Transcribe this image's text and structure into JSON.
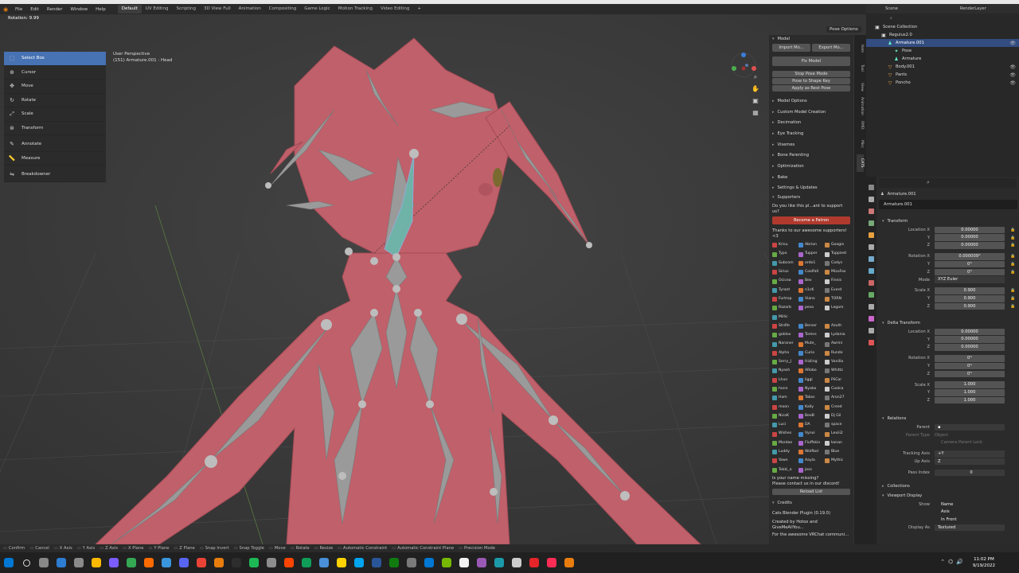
{
  "menubar": {
    "menus": [
      "File",
      "Edit",
      "Render",
      "Window",
      "Help"
    ],
    "workspaces": [
      "Default",
      "UV Editing",
      "Scripting",
      "3D View Full",
      "Animation",
      "Compositing",
      "Game Logic",
      "Motion Tracking",
      "Video Editing",
      "+"
    ],
    "active_workspace": "Default"
  },
  "viewport": {
    "operator_label": "Rotation: 9.99",
    "perspective": "User Perspective",
    "object_info": "(151) Armature.001 : Head",
    "pose_options": "Pose Options"
  },
  "toolbar": {
    "tools": [
      {
        "label": "Select Box",
        "icon": "select-box-icon",
        "glyph": "⬚"
      },
      {
        "label": "Cursor",
        "icon": "cursor-icon",
        "glyph": "⊕"
      },
      {
        "label": "Move",
        "icon": "move-icon",
        "glyph": "✥"
      },
      {
        "label": "Rotate",
        "icon": "rotate-icon",
        "glyph": "↻"
      },
      {
        "label": "Scale",
        "icon": "scale-icon",
        "glyph": "⤢"
      },
      {
        "label": "Transform",
        "icon": "transform-icon",
        "glyph": "⊛"
      },
      {
        "label": "Annotate",
        "icon": "annotate-icon",
        "glyph": "✎"
      },
      {
        "label": "Measure",
        "icon": "measure-icon",
        "glyph": "📏"
      },
      {
        "label": "Breakdowner",
        "icon": "breakdowner-icon",
        "glyph": "⇋"
      }
    ]
  },
  "npanel": {
    "model_header": "Model",
    "import_label": "Import Mo...",
    "export_label": "Export Mo...",
    "fix_model": "Fix Model",
    "stop_pose_mode": "Stop Pose Mode",
    "pose_to_shape_key": "Pose to Shape Key",
    "apply_as_rest_pose": "Apply as Rest Pose",
    "sections": [
      "Model Options",
      "Custom Model Creation",
      "Decimation",
      "Eye Tracking",
      "Visemes",
      "Bone Parenting",
      "Optimization",
      "Bake",
      "Settings & Updates"
    ],
    "supporters_header": "Supporters",
    "support_question": "Do you like this pl...ant to support us?",
    "become_patron": "Become a Patron",
    "thanks": "Thanks to our awesome supporters! <3",
    "supporters": [
      "Krisu",
      "Abrion",
      "Googie",
      "Typo",
      "Tupper",
      "Tuppiest",
      "Subcom",
      "ordo1",
      "Codys",
      "Sirius",
      "Coolfall",
      "MizuFox",
      "Ocicea",
      "Bex",
      "Finnis",
      "Tyrant",
      "n1cK",
      "Everd",
      "Furtrop",
      "Vianx",
      "TORN",
      "Razorb",
      "pesa",
      "Legom",
      "Millic",
      "",
      "",
      "Str4fe",
      "Berser",
      "Azuth",
      "goblox",
      "Tomns",
      "Lydania",
      "Naraner",
      "Mute_",
      "Awrini",
      "Alpha",
      "Curio",
      "Runde",
      "Serry_J",
      "Hizling",
      "Vanilla",
      "Nyash",
      "ARobo",
      "Whittz",
      "Lhun",
      "liggi",
      "PiiCar",
      "honn",
      "Nyako",
      "Coolca",
      "Ham",
      "Tabss",
      "Aron27",
      "moon",
      "Kally",
      "Creed",
      "NicoK",
      "BeeB",
      "Dj Gil",
      "Luci",
      "DA",
      "space",
      "Wishes",
      "Vynxi",
      "Lexiii2",
      "Mordae",
      "Fluffskin",
      "konan",
      "Luddy",
      "Wolfbol",
      "Blue",
      "Yawn",
      "Aayla",
      "Mythic",
      "Tokki_o",
      "jess",
      ""
    ],
    "missing_line1": "Is your name missing?",
    "missing_line2": "Please contact us in our discord!",
    "reload_list": "Reload List",
    "credits_header": "Credits",
    "plugin_version": "Cats Blender Plugin (0.19.0)",
    "created_by": "Created by Hotox and GiveMeAllYou...",
    "for_community": "For the awesome VRChat communi...",
    "tabs": [
      "Item",
      "Tool",
      "View",
      "Animation",
      "RMD",
      "Misc",
      "CATS"
    ],
    "active_tab": "CATS"
  },
  "outliner": {
    "scene": "Scene",
    "renderlayer": "RenderLayer",
    "rows": [
      {
        "label": "Scene Collection",
        "indent": 0,
        "icon": "collection-icon",
        "glyph": "▣",
        "sel": false
      },
      {
        "label": "Regulus2.0",
        "indent": 1,
        "icon": "collection-icon",
        "glyph": "▣",
        "sel": false
      },
      {
        "label": "Armature.001",
        "indent": 2,
        "icon": "armature-icon",
        "glyph": "♟",
        "sel": true
      },
      {
        "label": "Pose",
        "indent": 3,
        "icon": "pose-icon",
        "glyph": "✦",
        "sel": false
      },
      {
        "label": "Armature",
        "indent": 3,
        "icon": "armature-data-icon",
        "glyph": "♟",
        "sel": false
      },
      {
        "label": "Body.001",
        "indent": 2,
        "icon": "mesh-icon",
        "glyph": "▽",
        "sel": false
      },
      {
        "label": "Pants",
        "indent": 2,
        "icon": "mesh-icon",
        "glyph": "▽",
        "sel": false
      },
      {
        "label": "Poncho",
        "indent": 2,
        "icon": "mesh-icon",
        "glyph": "▽",
        "sel": false
      }
    ]
  },
  "properties": {
    "object_name": "Armature.001",
    "name_field": "Armature.001",
    "transform": "Transform",
    "location": {
      "x": "0.00000",
      "y": "0.00000",
      "z": "0.00000"
    },
    "rotation": {
      "x": "0.000009°",
      "y": "0°",
      "z": "0°"
    },
    "mode": "XYZ Euler",
    "scale": {
      "x": "0.900",
      "y": "0.900",
      "z": "0.900"
    },
    "delta_transform": "Delta Transform",
    "delta_location": {
      "x": "0.00000",
      "y": "0.00000",
      "z": "0.00000"
    },
    "delta_rotation": {
      "x": "0°",
      "y": "0°",
      "z": "0°"
    },
    "delta_scale": {
      "x": "1.000",
      "y": "1.000",
      "z": "1.000"
    },
    "relations": "Relations",
    "parent_type": "Object",
    "camera_parent_lock": "Camera Parent Lock",
    "tracking_axis": "+Y",
    "up_axis": "Z",
    "pass_index": "0",
    "collections": "Collections",
    "viewport_display": "Viewport Display",
    "show_items": [
      "Name",
      "Axis",
      "In Front"
    ],
    "display_as": "Textured",
    "labels": {
      "location_x": "Location X",
      "y": "Y",
      "z": "Z",
      "rotation_x": "Rotation X",
      "mode": "Mode",
      "scale_x": "Scale X",
      "parent": "Parent",
      "parent_type": "Parent Type",
      "tracking_axis": "Tracking Axis",
      "up_axis": "Up Axis",
      "pass_index": "Pass Index",
      "show": "Show",
      "display_as": "Display As"
    }
  },
  "statusbar": {
    "items": [
      "Confirm",
      "Cancel",
      "X Axis",
      "Y Axis",
      "Z Axis",
      "X Plane",
      "Y Plane",
      "Z Plane",
      "Snap Invert",
      "Snap Toggle",
      "Move",
      "Rotate",
      "Resize",
      "Automatic Constraint",
      "Automatic Constraint Plane",
      "Precision Mode"
    ]
  },
  "taskbar": {
    "time": "11:02 PM",
    "date": "9/19/2022",
    "apps": [
      "#0078d4",
      "#555555",
      "#888888",
      "#2d7dd2",
      "#8a8a8a",
      "#ffb900",
      "#7b5cff",
      "#34a853",
      "#ff6b00",
      "#3a96dd",
      "#5865f2",
      "#ea4335",
      "#e87d0d",
      "#2d2d2d",
      "#1db954",
      "#8d8d8d",
      "#ff4500",
      "#0f9d58",
      "#4a90d9",
      "#ffd200",
      "#00a4ef",
      "#2a5699",
      "#107c10",
      "#7a7a7a",
      "#0078d4",
      "#76b900",
      "#f2f2f2",
      "#9b59b6",
      "#1b9aaa",
      "#cccccc",
      "#e5252a",
      "#ff2d55",
      "#e87d0d"
    ]
  },
  "colors": {
    "accent": "#4772b3",
    "model": "#c0606a",
    "bone": "#9a9a9a",
    "active_bone": "#6fb3a8"
  }
}
